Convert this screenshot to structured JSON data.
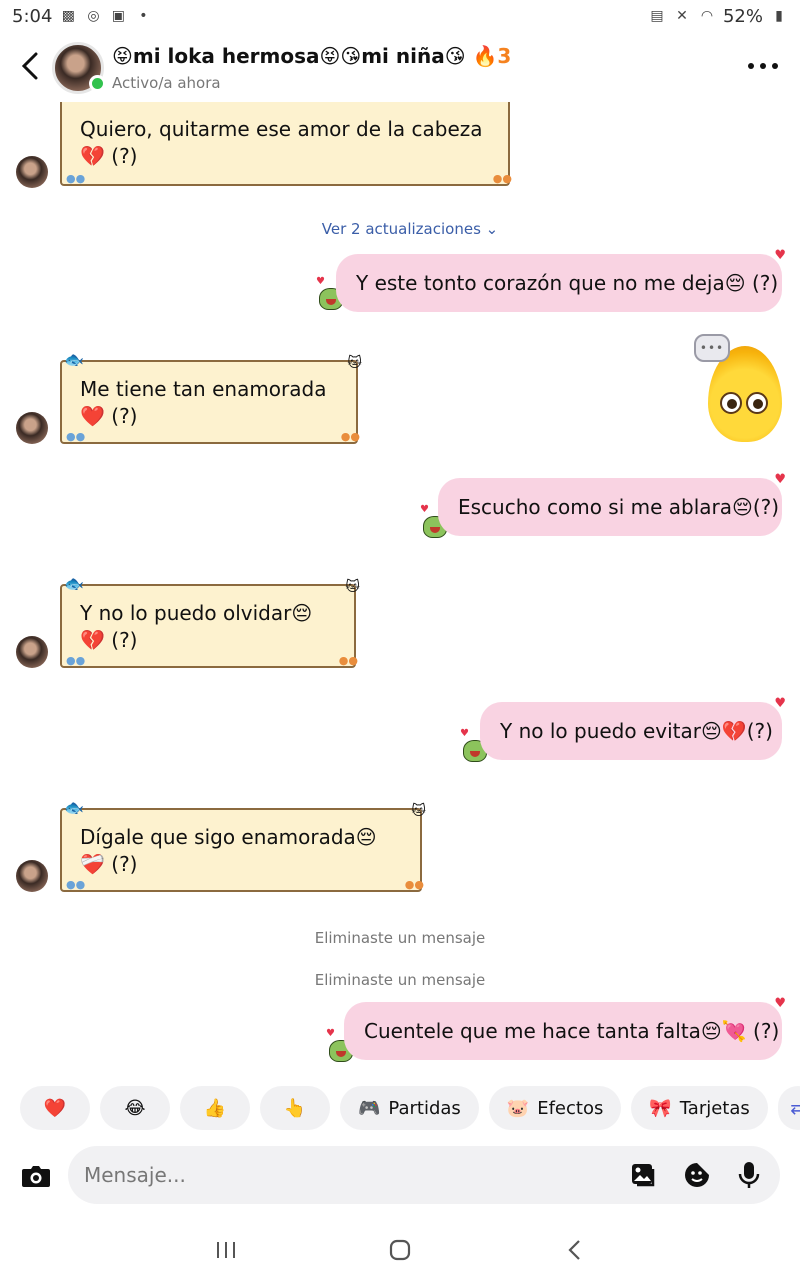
{
  "status_bar": {
    "time": "5:04",
    "battery": "52%"
  },
  "header": {
    "title_name": "😝mi loka hermosa😝😘mi niña😘",
    "streak_icon": "🔥",
    "streak_count": "3",
    "subtitle": "Activo/a ahora"
  },
  "messages": {
    "m1": {
      "text": "Quiero, quitarme ese amor de la cabeza 💔 (?)"
    },
    "updates_link": "Ver 2 actualizaciones",
    "m2": {
      "text": "Y este tonto corazón que no me deja😔 (?)"
    },
    "m3": {
      "text": "Me tiene tan enamorada❤️ (?)"
    },
    "m4": {
      "text": "Escucho como si me ablara😔(?)"
    },
    "m5": {
      "text": "Y no lo puedo olvidar😔💔 (?)"
    },
    "m6": {
      "text": "Y no lo puedo evitar😔💔(?)"
    },
    "m7": {
      "text": "Dígale que sigo enamorada😔 ❤️‍🩹 (?)"
    },
    "deleted_1": "Eliminaste un mensaje",
    "deleted_2": "Eliminaste un mensaje",
    "m8": {
      "text": "Cuentele que me hace tanta falta😔💘 (?)"
    }
  },
  "sticker": {
    "bubble_text": "•••"
  },
  "quick_replies": [
    {
      "icon": "❤️"
    },
    {
      "icon": "😂"
    },
    {
      "icon": "👍"
    },
    {
      "icon": "👆"
    },
    {
      "icon": "🎮",
      "label": "Partidas"
    },
    {
      "icon": "🐷",
      "label": "Efectos"
    },
    {
      "icon": "🎀",
      "label": "Tarjetas"
    }
  ],
  "composer": {
    "placeholder": "Mensaje..."
  },
  "colors": {
    "incoming_bg": "#fdf2cf",
    "outgoing_bg": "#f9d3e2",
    "link": "#3b5ea8"
  }
}
